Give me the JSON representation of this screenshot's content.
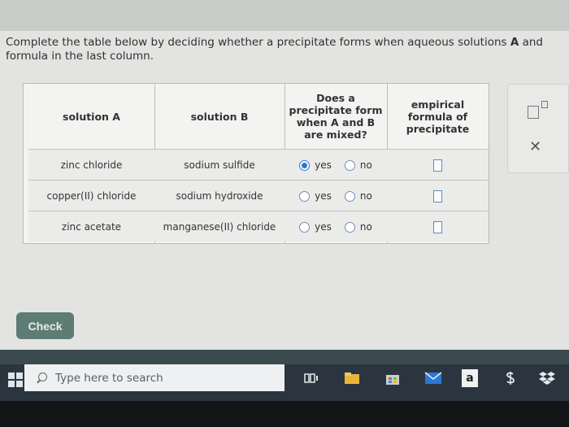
{
  "question": {
    "part1": "Complete the table below by deciding whether a precipitate forms when aqueous solutions ",
    "a": "A",
    "part2": " and",
    "line2": "formula in the last column."
  },
  "table": {
    "headers": {
      "solution_a": "solution A",
      "solution_b": "solution B",
      "precipitate_q": [
        "Does a",
        "precipitate form",
        "when A and B",
        "are mixed?"
      ],
      "formula": [
        "empirical",
        "formula of",
        "precipitate"
      ]
    },
    "rows": [
      {
        "solution_a": "zinc chloride",
        "solution_b": "sodium sulfide",
        "selected": "yes"
      },
      {
        "solution_a": "copper(II) chloride",
        "solution_b": "sodium hydroxide",
        "selected": "none"
      },
      {
        "solution_a": "zinc acetate",
        "solution_b": "manganese(II) chloride",
        "selected": "none"
      }
    ],
    "yes_label": "yes",
    "no_label": "no"
  },
  "side_panel": {
    "superscript_icon": "superscript-icon",
    "close_icon": "close-icon",
    "close_glyph": "✕"
  },
  "check_button": {
    "label": "Check"
  },
  "taskbar": {
    "search_placeholder": "Type here to search",
    "icons": [
      "windows-icon",
      "task-view-icon",
      "file-explorer-icon",
      "store-icon",
      "mail-icon",
      "amazon-icon",
      "dollar-icon",
      "dropbox-icon"
    ],
    "amazon_label": "a"
  },
  "colors": {
    "accent": "#2f79c9",
    "check_button": "#5d7c74",
    "taskbar": "#2b3540"
  }
}
